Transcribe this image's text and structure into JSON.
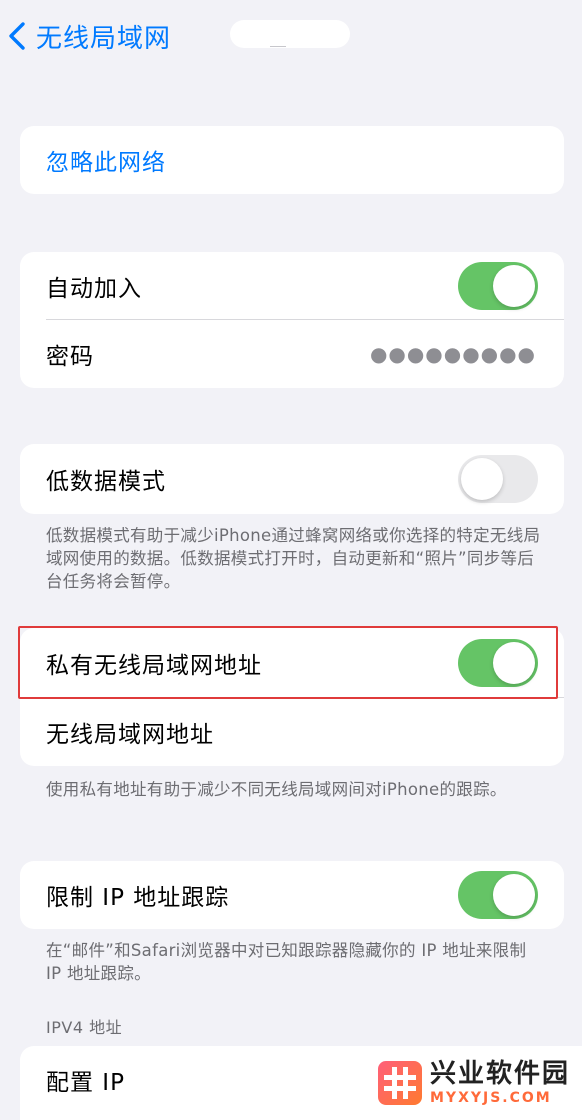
{
  "nav": {
    "back_label": "无线局域网"
  },
  "forget": {
    "label": "忽略此网络"
  },
  "join_group": {
    "auto_join_label": "自动加入",
    "auto_join_on": true,
    "password_label": "密码",
    "password_mask": "●●●●●●●●●"
  },
  "low_data": {
    "label": "低数据模式",
    "on": false,
    "footnote": "低数据模式有助于减少iPhone通过蜂窝网络或你选择的特定无线局域网使用的数据。低数据模式打开时，自动更新和“照片”同步等后台任务将会暂停。"
  },
  "private_address": {
    "label": "私有无线局域网地址",
    "on": true,
    "wifi_address_label": "无线局域网地址",
    "footnote": "使用私有地址有助于减少不同无线局域网间对iPhone的跟踪。"
  },
  "limit_tracking": {
    "label": "限制 IP 地址跟踪",
    "on": true,
    "footnote": "在“邮件”和Safari浏览器中对已知跟踪器隐藏你的 IP 地址来限制 IP 地址跟踪。"
  },
  "ipv4": {
    "header": "IPV4 地址",
    "configure_ip_label": "配置 IP"
  },
  "watermark": {
    "cn": "兴业软件园",
    "en": "MYXYJS.COM"
  },
  "colors": {
    "accent": "#007aff",
    "toggle_on": "#65c466",
    "highlight": "#e03b3b"
  }
}
